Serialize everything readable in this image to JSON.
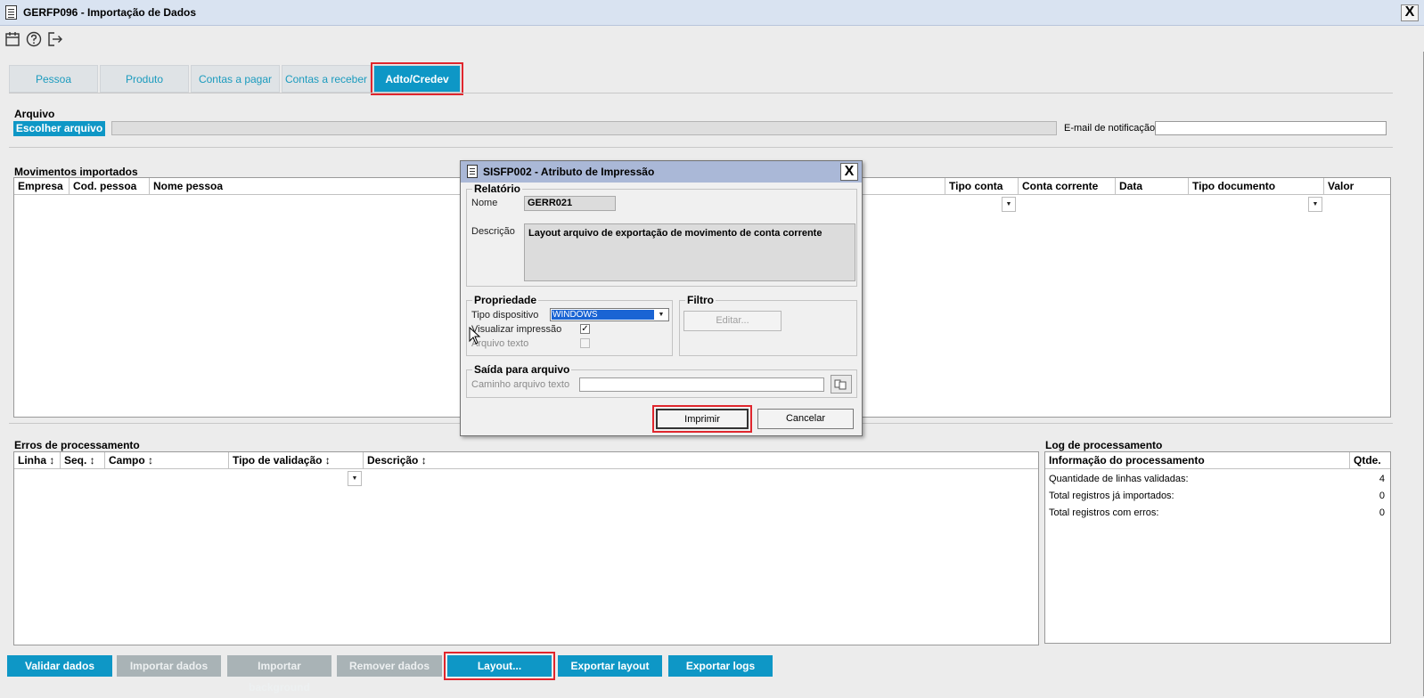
{
  "window": {
    "title": "GERFP096 - Importação de Dados",
    "close_label": "X"
  },
  "toolbar": {
    "icons": [
      "calendar-icon",
      "help-icon",
      "logout-icon"
    ]
  },
  "tabs": [
    {
      "label": "Pessoa"
    },
    {
      "label": "Produto"
    },
    {
      "label": "Contas a pagar"
    },
    {
      "label": "Contas a receber"
    },
    {
      "label": "Adto/Credev",
      "active": true
    }
  ],
  "arquivo": {
    "section_label": "Arquivo",
    "choose_button": "Escolher arquivo",
    "file_path": "",
    "email_label": "E-mail de notificação",
    "email_value": ""
  },
  "movimentos": {
    "section_label": "Movimentos importados",
    "columns": [
      "Empresa",
      "Cod. pessoa",
      "Nome pessoa",
      "Tipo conta",
      "Conta corrente",
      "Data",
      "Tipo documento",
      "Valor"
    ]
  },
  "erros": {
    "section_label": "Erros de processamento",
    "columns": [
      "Linha ↕",
      "Seq. ↕",
      "Campo ↕",
      "Tipo de validação ↕",
      "Descrição ↕"
    ]
  },
  "log": {
    "section_label": "Log de processamento",
    "columns": [
      "Informação do processamento",
      "Qtde."
    ],
    "rows": [
      {
        "label": "Quantidade de linhas validadas:",
        "value": "4"
      },
      {
        "label": "Total registros já importados:",
        "value": "0"
      },
      {
        "label": "Total registros com erros:",
        "value": "0"
      }
    ]
  },
  "bottom_buttons": {
    "validar": "Validar dados",
    "importar": "Importar dados",
    "importar_bg": "Importar background",
    "remover": "Remover dados",
    "layout": "Layout...",
    "exportar_layout": "Exportar layout",
    "exportar_logs": "Exportar logs"
  },
  "dialog": {
    "title": "SISFP002 - Atributo de Impressão",
    "close_label": "X",
    "relatorio": {
      "label": "Relatório",
      "nome_label": "Nome",
      "nome_value": "GERR021",
      "descricao_label": "Descrição",
      "descricao_value": "Layout arquivo de exportação de movimento de conta corrente"
    },
    "propriedade": {
      "label": "Propriedade",
      "tipo_dispositivo_label": "Tipo dispositivo",
      "tipo_dispositivo_value": "WINDOWS",
      "visualizar_label": "Visualizar impressão",
      "visualizar_checked": true,
      "arquivo_texto_label": "Arquivo texto",
      "arquivo_texto_checked": false
    },
    "filtro": {
      "label": "Filtro",
      "editar_button": "Editar..."
    },
    "saida": {
      "label": "Saída para arquivo",
      "caminho_label": "Caminho arquivo texto",
      "caminho_value": ""
    },
    "imprimir_button": "Imprimir",
    "cancelar_button": "Cancelar"
  },
  "colors": {
    "accent": "#0e97c6",
    "highlight": "#e0262d",
    "disabled_button": "#a9b3b6",
    "titlebar": "#d9e3f1",
    "dialog_titlebar": "#aab8d7"
  }
}
